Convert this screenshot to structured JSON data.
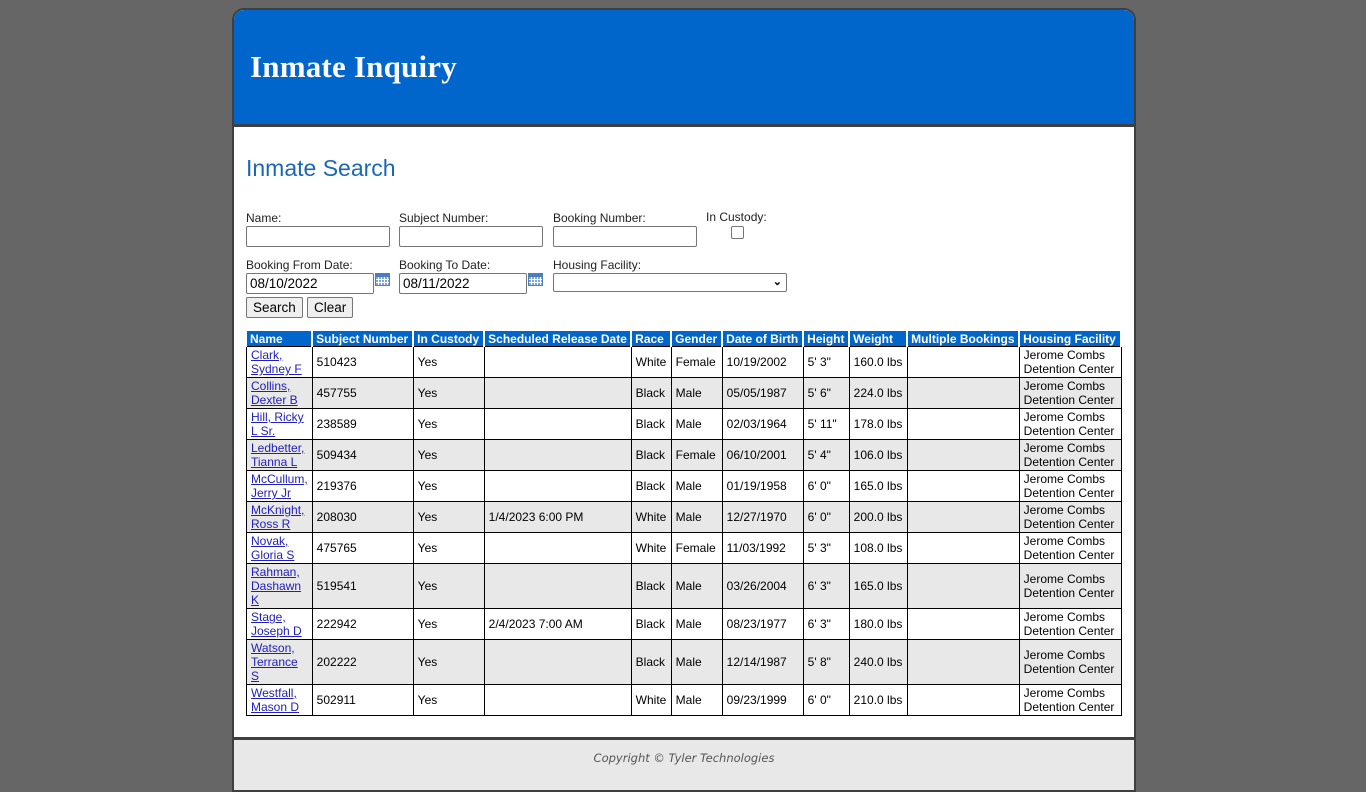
{
  "header": {
    "title": "Inmate Inquiry"
  },
  "search": {
    "title": "Inmate Search",
    "fields": {
      "name": {
        "label": "Name:",
        "value": ""
      },
      "subject_number": {
        "label": "Subject Number:",
        "value": ""
      },
      "booking_number": {
        "label": "Booking Number:",
        "value": ""
      },
      "in_custody": {
        "label": "In Custody:",
        "checked": false
      },
      "booking_from_date": {
        "label": "Booking From Date:",
        "value": "08/10/2022"
      },
      "booking_to_date": {
        "label": "Booking To Date:",
        "value": "08/11/2022"
      },
      "housing_facility": {
        "label": "Housing Facility:",
        "value": ""
      }
    },
    "icons": {
      "calendar": "calendar-icon",
      "dropdown": "chevron-down-icon"
    },
    "buttons": {
      "search": "Search",
      "clear": "Clear"
    }
  },
  "results": {
    "columns": [
      "Name",
      "Subject Number",
      "In Custody",
      "Scheduled Release Date",
      "Race",
      "Gender",
      "Date of Birth",
      "Height",
      "Weight",
      "Multiple Bookings",
      "Housing Facility"
    ],
    "rows": [
      {
        "name": "Clark, Sydney F",
        "subject_number": "510423",
        "in_custody": "Yes",
        "release": "",
        "race": "White",
        "gender": "Female",
        "dob": "10/19/2002",
        "height": "5' 3\"",
        "weight": "160.0 lbs",
        "multiple": "",
        "facility": "Jerome Combs Detention Center"
      },
      {
        "name": "Collins, Dexter B",
        "subject_number": "457755",
        "in_custody": "Yes",
        "release": "",
        "race": "Black",
        "gender": "Male",
        "dob": "05/05/1987",
        "height": "5' 6\"",
        "weight": "224.0 lbs",
        "multiple": "",
        "facility": "Jerome Combs Detention Center"
      },
      {
        "name": "Hill, Ricky L Sr.",
        "subject_number": "238589",
        "in_custody": "Yes",
        "release": "",
        "race": "Black",
        "gender": "Male",
        "dob": "02/03/1964",
        "height": "5' 11\"",
        "weight": "178.0 lbs",
        "multiple": "",
        "facility": "Jerome Combs Detention Center"
      },
      {
        "name": "Ledbetter, Tianna L",
        "subject_number": "509434",
        "in_custody": "Yes",
        "release": "",
        "race": "Black",
        "gender": "Female",
        "dob": "06/10/2001",
        "height": "5' 4\"",
        "weight": "106.0 lbs",
        "multiple": "",
        "facility": "Jerome Combs Detention Center"
      },
      {
        "name": "McCullum, Jerry Jr",
        "subject_number": "219376",
        "in_custody": "Yes",
        "release": "",
        "race": "Black",
        "gender": "Male",
        "dob": "01/19/1958",
        "height": "6' 0\"",
        "weight": "165.0 lbs",
        "multiple": "",
        "facility": "Jerome Combs Detention Center"
      },
      {
        "name": "McKnight, Ross R",
        "subject_number": "208030",
        "in_custody": "Yes",
        "release": "1/4/2023 6:00 PM",
        "race": "White",
        "gender": "Male",
        "dob": "12/27/1970",
        "height": "6' 0\"",
        "weight": "200.0 lbs",
        "multiple": "",
        "facility": "Jerome Combs Detention Center"
      },
      {
        "name": "Novak, Gloria S",
        "subject_number": "475765",
        "in_custody": "Yes",
        "release": "",
        "race": "White",
        "gender": "Female",
        "dob": "11/03/1992",
        "height": "5' 3\"",
        "weight": "108.0 lbs",
        "multiple": "",
        "facility": "Jerome Combs Detention Center"
      },
      {
        "name": "Rahman, Dashawn K",
        "subject_number": "519541",
        "in_custody": "Yes",
        "release": "",
        "race": "Black",
        "gender": "Male",
        "dob": "03/26/2004",
        "height": "6' 3\"",
        "weight": "165.0 lbs",
        "multiple": "",
        "facility": "Jerome Combs Detention Center"
      },
      {
        "name": "Stage, Joseph D",
        "subject_number": "222942",
        "in_custody": "Yes",
        "release": "2/4/2023 7:00 AM",
        "race": "Black",
        "gender": "Male",
        "dob": "08/23/1977",
        "height": "6' 3\"",
        "weight": "180.0 lbs",
        "multiple": "",
        "facility": "Jerome Combs Detention Center"
      },
      {
        "name": "Watson, Terrance S",
        "subject_number": "202222",
        "in_custody": "Yes",
        "release": "",
        "race": "Black",
        "gender": "Male",
        "dob": "12/14/1987",
        "height": "5' 8\"",
        "weight": "240.0 lbs",
        "multiple": "",
        "facility": "Jerome Combs Detention Center"
      },
      {
        "name": "Westfall, Mason D",
        "subject_number": "502911",
        "in_custody": "Yes",
        "release": "",
        "race": "White",
        "gender": "Male",
        "dob": "09/23/1999",
        "height": "6' 0\"",
        "weight": "210.0 lbs",
        "multiple": "",
        "facility": "Jerome Combs Detention Center"
      }
    ]
  },
  "footer": {
    "copyright": "Copyright © Tyler Technologies"
  },
  "colors": {
    "brand_blue": "#0066cc",
    "heading_blue": "#1a67b8",
    "background": "#666666",
    "alt_row": "#e8e8e8"
  }
}
